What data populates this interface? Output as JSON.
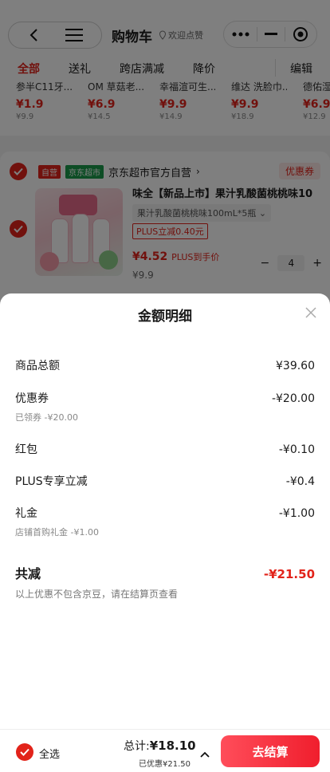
{
  "colors": {
    "accent": "#e2231a",
    "chaoshi_green": "#1a9a4a"
  },
  "nav": {
    "back_icon": "chevron-left-icon",
    "menu_icon": "hamburger-icon",
    "title": "购物车",
    "welcome": "欢迎点赞",
    "more_icon": "more-dots-icon",
    "minimize_icon": "minimize-icon",
    "close_icon": "target-icon"
  },
  "tabs": {
    "items": [
      {
        "label": "全部",
        "active": true
      },
      {
        "label": "送礼",
        "active": false
      },
      {
        "label": "跨店满减",
        "active": false
      },
      {
        "label": "降价",
        "active": false
      }
    ],
    "edit": "编辑"
  },
  "recommend": [
    {
      "name": "参半C11牙...",
      "price": "¥1.9",
      "old": "¥9.9"
    },
    {
      "name": "OM 草菇老...",
      "price": "¥6.9",
      "old": "¥14.5"
    },
    {
      "name": "幸福渲可生...",
      "price": "¥9.9",
      "old": "¥14.9"
    },
    {
      "name": "维达 洗脸巾...",
      "price": "¥9.9",
      "old": "¥18.9"
    },
    {
      "name": "德佑湿...",
      "price": "¥6.9",
      "old": "¥12.9"
    }
  ],
  "store": {
    "badge_self": "自营",
    "badge_chaoshi": "京东超市",
    "name": "京东超市官方自营",
    "coupon": "优惠券"
  },
  "product": {
    "title": "味全【新品上市】果汁乳酸菌桃桃味10",
    "spec": "果汁乳酸菌桃桃味100mL*5瓶",
    "plus_tag": "PLUS立减0.40元",
    "price": "¥4.52",
    "plus_price_label": "PLUS到手价",
    "old_price": "¥9.9",
    "quantity": "4"
  },
  "sheet": {
    "title": "金额明细",
    "lines": [
      {
        "label": "商品总额",
        "amount": "¥39.60"
      },
      {
        "label": "优惠券",
        "amount": "-¥20.00",
        "sub": "已领券 -¥20.00"
      },
      {
        "label": "红包",
        "amount": "-¥0.10"
      },
      {
        "label": "PLUS专享立减",
        "amount": "-¥0.4"
      },
      {
        "label": "礼金",
        "amount": "-¥1.00",
        "sub": "店铺首购礼金 -¥1.00"
      }
    ],
    "total_label": "共减",
    "total_amount": "-¥21.50",
    "note": "以上优惠不包含京豆，请在结算页查看"
  },
  "footer": {
    "select_all": "全选",
    "total_label": "总计:",
    "total_amount": "¥18.10",
    "saved": "已优惠¥21.50",
    "checkout": "去结算"
  }
}
